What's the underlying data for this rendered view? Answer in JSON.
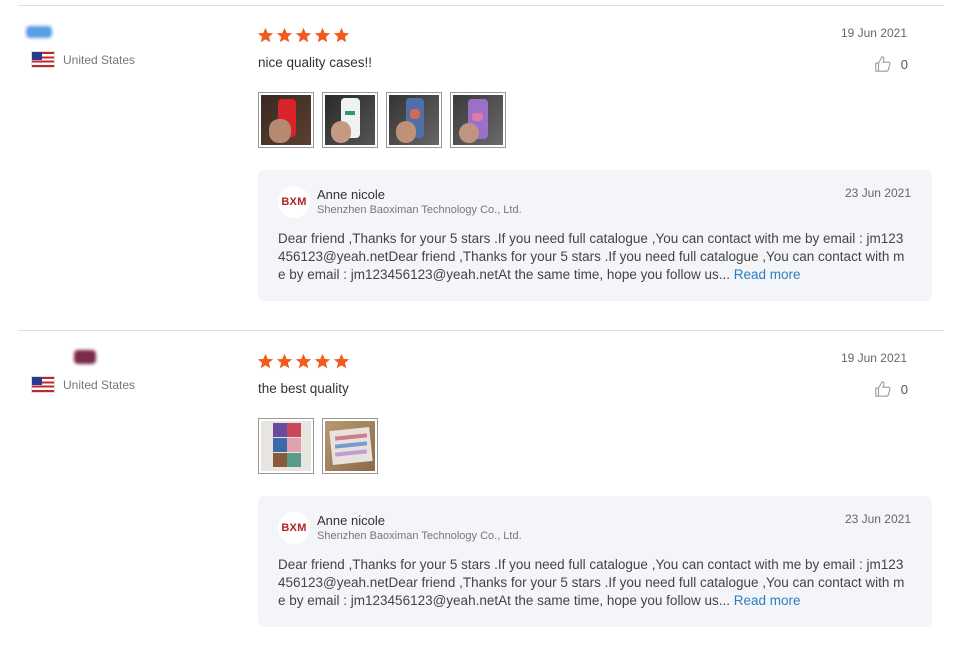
{
  "reviews": [
    {
      "country": "United States",
      "rating": 5,
      "date": "19 Jun 2021",
      "comment": "nice quality cases!!",
      "likes": "0",
      "photos": [
        "photo-red-case",
        "photo-white-case",
        "photo-blue-case",
        "photo-purple-case"
      ],
      "reply": {
        "logo_text": "BXM",
        "seller": "Anne nicole",
        "store": "Shenzhen Baoximan Technology Co., Ltd.",
        "date": "23 Jun 2021",
        "text": "Dear friend ,Thanks for your 5 stars .If you need full catalogue ,You can contact with me by email  : jm123456123@yeah.netDear friend ,Thanks for your 5 stars .If you need full catalogue ,You can contact with me by email  : jm123456123@yeah.netAt the same time, hope you follow us...",
        "read_more": "Read more"
      }
    },
    {
      "country": "United States",
      "rating": 5,
      "date": "19 Jun 2021",
      "comment": "the best quality",
      "likes": "0",
      "photos": [
        "photo-cases-collage",
        "photo-box-of-cases"
      ],
      "reply": {
        "logo_text": "BXM",
        "seller": "Anne nicole",
        "store": "Shenzhen Baoximan Technology Co., Ltd.",
        "date": "23 Jun 2021",
        "text": "Dear friend ,Thanks for your 5 stars .If you need full catalogue ,You can contact with me by email  : jm123456123@yeah.netDear friend ,Thanks for your 5 stars .If you need full catalogue ,You can contact with me by email  : jm123456123@yeah.netAt the same time, hope you follow us...",
        "read_more": "Read more"
      }
    }
  ],
  "colors": {
    "star": "#f25a1e",
    "link": "#2b7fc1",
    "reply_bg": "#f4f5f8"
  }
}
